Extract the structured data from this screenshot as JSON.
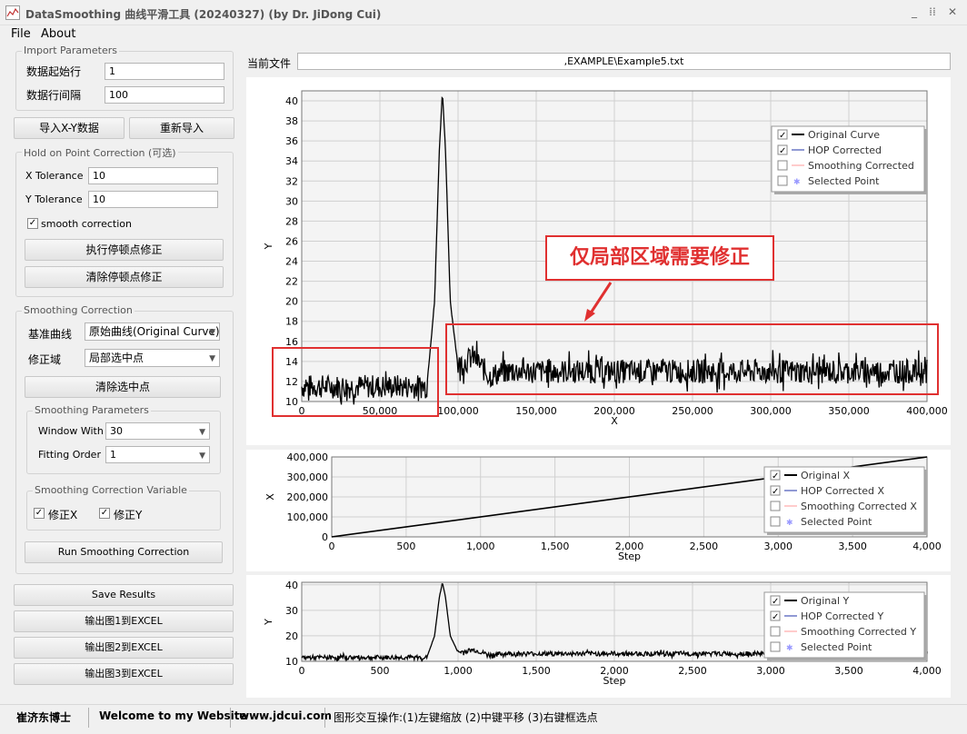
{
  "window": {
    "title": "DataSmoothing 曲线平滑工具 (20240327) (by Dr. JiDong Cui)",
    "minimize": "_",
    "maximize": "⁞⁞",
    "close": "✕"
  },
  "menu": {
    "file": "File",
    "about": "About"
  },
  "import": {
    "title": "Import Parameters",
    "start_row_label": "数据起始行",
    "start_row_value": "1",
    "row_interval_label": "数据行间隔",
    "row_interval_value": "100",
    "import_btn": "导入X-Y数据",
    "reimport_btn": "重新导入"
  },
  "hop": {
    "title": "Hold on Point Correction (可选)",
    "x_tol_label": "X Tolerance",
    "x_tol_value": "10",
    "y_tol_label": "Y Tolerance",
    "y_tol_value": "10",
    "smooth_label": "smooth correction",
    "smooth_checked": true,
    "execute_btn": "执行停顿点修正",
    "clear_btn": "清除停顿点修正"
  },
  "smoothing": {
    "title": "Smoothing Correction",
    "base_curve_label": "基准曲线",
    "base_curve_value": "原始曲线(Original Curve)",
    "domain_label": "修正域",
    "domain_value": "局部选中点",
    "clear_selected_btn": "清除选中点",
    "params_title": "Smoothing Parameters",
    "window_label": "Window With",
    "window_value": "30",
    "order_label": "Fitting Order",
    "order_value": "1",
    "variable_title": "Smoothing Correction Variable",
    "fix_x_label": "修正X",
    "fix_y_label": "修正Y",
    "run_btn": "Run Smoothing Correction"
  },
  "actions": {
    "save": "Save Results",
    "export1": "输出图1到EXCEL",
    "export2": "输出图2到EXCEL",
    "export3": "输出图3到EXCEL"
  },
  "current_file": {
    "label": "当前文件",
    "value": ",EXAMPLE\\Example5.txt"
  },
  "annotation": {
    "text": "仅局部区域需要修正"
  },
  "status": {
    "author": "崔济东博士",
    "welcome": "Welcome to my Website",
    "site": "www.jdcui.com",
    "hint": "图形交互操作:(1)左键缩放 (2)中键平移 (3)右键框选点"
  },
  "colors": {
    "curve": "#000000",
    "hop": "#2233aa",
    "smooth": "#ff9999",
    "selected": "#9999ff",
    "annotation_red": "#e03030"
  },
  "chart_data": [
    {
      "type": "line",
      "xlabel": "X",
      "ylabel": "Y",
      "xlim": [
        0,
        400000
      ],
      "ylim": [
        10,
        41
      ],
      "x_ticks": [
        "0",
        "50,000",
        "100,000",
        "150,000",
        "200,000",
        "250,000",
        "300,000",
        "350,000",
        "400,000"
      ],
      "y_ticks": [
        "10",
        "12",
        "14",
        "16",
        "18",
        "20",
        "22",
        "24",
        "26",
        "28",
        "30",
        "32",
        "34",
        "36",
        "38",
        "40"
      ],
      "legend": [
        "Original Curve",
        "HOP Corrected",
        "Smoothing Corrected",
        "Selected Point"
      ],
      "legend_checked": [
        true,
        true,
        false,
        false
      ],
      "legend_position": "top-right",
      "grid": true,
      "series": [
        {
          "name": "Original Curve",
          "x": [
            0,
            80000,
            85000,
            88000,
            90000,
            92000,
            95000,
            100000,
            105000,
            110000,
            120000,
            130000,
            200000,
            300000,
            400000
          ],
          "y": [
            11.5,
            11.5,
            20,
            35,
            41,
            35,
            20,
            13.5,
            14,
            14.5,
            12.5,
            13,
            13,
            13,
            13
          ]
        }
      ]
    },
    {
      "type": "line",
      "xlabel": "Step",
      "ylabel": "X",
      "xlim": [
        0,
        4000
      ],
      "ylim": [
        0,
        400000
      ],
      "x_ticks": [
        "0",
        "500",
        "1,000",
        "1,500",
        "2,000",
        "2,500",
        "3,000",
        "3,500",
        "4,000"
      ],
      "y_ticks": [
        "0",
        "100,000",
        "200,000",
        "300,000",
        "400,000"
      ],
      "legend": [
        "Original X",
        "HOP Corrected X",
        "Smoothing Corrected X",
        "Selected Point"
      ],
      "legend_checked": [
        true,
        true,
        false,
        false
      ],
      "legend_position": "top-right",
      "grid": true,
      "series": [
        {
          "name": "Original X",
          "x": [
            0,
            4000
          ],
          "y": [
            0,
            400000
          ]
        }
      ]
    },
    {
      "type": "line",
      "xlabel": "Step",
      "ylabel": "Y",
      "xlim": [
        0,
        4000
      ],
      "ylim": [
        10,
        41
      ],
      "x_ticks": [
        "0",
        "500",
        "1,000",
        "1,500",
        "2,000",
        "2,500",
        "3,000",
        "3,500",
        "4,000"
      ],
      "y_ticks": [
        "10",
        "20",
        "30",
        "40"
      ],
      "legend": [
        "Original Y",
        "HOP Corrected Y",
        "Smoothing Corrected Y",
        "Selected Point"
      ],
      "legend_checked": [
        true,
        true,
        false,
        false
      ],
      "legend_position": "top-right",
      "grid": true,
      "series": [
        {
          "name": "Original Y",
          "x": [
            0,
            800,
            850,
            880,
            900,
            920,
            950,
            1000,
            1050,
            1100,
            1200,
            1300,
            2000,
            3000,
            4000
          ],
          "y": [
            11.5,
            11.5,
            20,
            35,
            41,
            35,
            20,
            13.5,
            14,
            14.5,
            12.5,
            13,
            13,
            13,
            13
          ]
        }
      ]
    }
  ]
}
